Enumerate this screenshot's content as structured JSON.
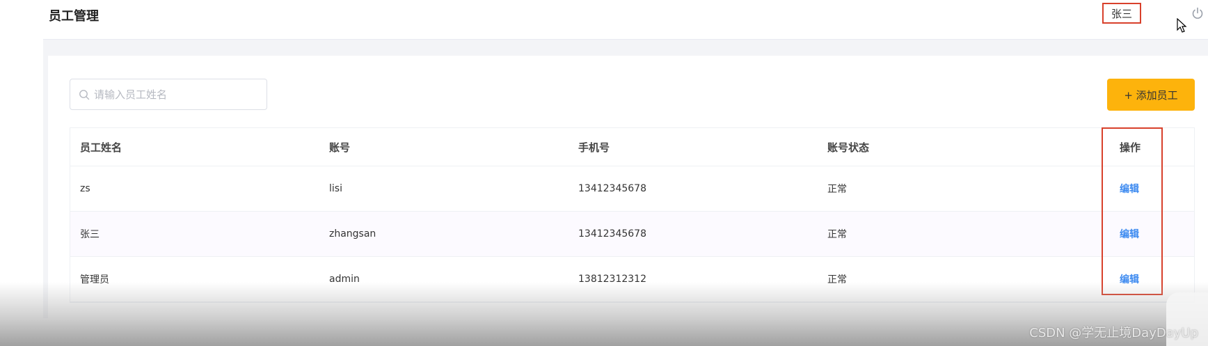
{
  "header": {
    "title": "员工管理",
    "user_name": "张三"
  },
  "search": {
    "placeholder": "请输入员工姓名",
    "value": ""
  },
  "actions": {
    "add_label": "+ 添加员工"
  },
  "table": {
    "columns": [
      "员工姓名",
      "账号",
      "手机号",
      "账号状态",
      "操作"
    ],
    "rows": [
      {
        "name": "zs",
        "account": "lisi",
        "phone": "13412345678",
        "status": "正常",
        "action": "编辑"
      },
      {
        "name": "张三",
        "account": "zhangsan",
        "phone": "13412345678",
        "status": "正常",
        "action": "编辑"
      },
      {
        "name": "管理员",
        "account": "admin",
        "phone": "13812312312",
        "status": "正常",
        "action": "编辑"
      }
    ]
  },
  "watermark": "CSDN @学无止境DayDayUp",
  "colors": {
    "accent": "#fdb30c",
    "link": "#3e8bf0",
    "highlight": "#d8402b"
  }
}
